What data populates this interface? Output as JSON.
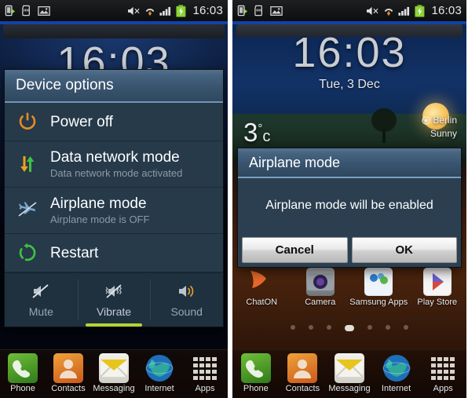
{
  "status_bar": {
    "icons": [
      "usb-transfer-icon",
      "sd-card-icon",
      "screenshot-image-icon"
    ],
    "right_icons": [
      "sound-muted-icon",
      "wifi-icon",
      "signal-bars-icon",
      "battery-charging-icon"
    ],
    "clock": "16:03"
  },
  "left_phone": {
    "lockscreen_clock": "16:03",
    "dialog": {
      "title": "Device options",
      "options": [
        {
          "label": "Power off",
          "sub": "",
          "icon": "power-icon"
        },
        {
          "label": "Data network mode",
          "sub": "Data network mode activated",
          "icon": "data-network-icon"
        },
        {
          "label": "Airplane mode",
          "sub": "Airplane mode is OFF",
          "icon": "airplane-icon"
        },
        {
          "label": "Restart",
          "sub": "",
          "icon": "restart-icon"
        }
      ],
      "sound_modes": [
        {
          "label": "Mute",
          "icon": "mute-icon",
          "active": false
        },
        {
          "label": "Vibrate",
          "icon": "vibrate-icon",
          "active": true
        },
        {
          "label": "Sound",
          "icon": "sound-on-icon",
          "active": false
        }
      ]
    },
    "dock": [
      {
        "label": "Phone",
        "icon": "phone-icon"
      },
      {
        "label": "Contacts",
        "icon": "contacts-icon"
      },
      {
        "label": "Messaging",
        "icon": "messaging-icon"
      },
      {
        "label": "Internet",
        "icon": "internet-icon"
      },
      {
        "label": "Apps",
        "icon": "apps-grid-icon"
      }
    ]
  },
  "right_phone": {
    "clock": "16:03",
    "date": "Tue, 3 Dec",
    "weather": {
      "temperature": "3",
      "degree_symbol": "°",
      "unit": "c",
      "location": "Berlin",
      "condition": "Sunny"
    },
    "dialog": {
      "title": "Airplane mode",
      "message": "Airplane mode will be enabled",
      "cancel_label": "Cancel",
      "ok_label": "OK"
    },
    "apps": [
      {
        "label": "ChatON",
        "icon": "chaton-icon"
      },
      {
        "label": "Camera",
        "icon": "camera-icon"
      },
      {
        "label": "Samsung Apps",
        "icon": "samsung-apps-icon"
      },
      {
        "label": "Play Store",
        "icon": "play-store-icon"
      }
    ],
    "page_dots": {
      "count": 7,
      "active_index": 3
    },
    "dock": [
      {
        "label": "Phone",
        "icon": "phone-icon"
      },
      {
        "label": "Contacts",
        "icon": "contacts-icon"
      },
      {
        "label": "Messaging",
        "icon": "messaging-icon"
      },
      {
        "label": "Internet",
        "icon": "internet-icon"
      },
      {
        "label": "Apps",
        "icon": "apps-grid-icon"
      }
    ]
  },
  "colors": {
    "dialog_title_top": "#54708c",
    "dialog_body": "#263a4a",
    "accent_green": "#b5d334",
    "power_orange": "#e88b22",
    "status_bar": "#141516"
  }
}
